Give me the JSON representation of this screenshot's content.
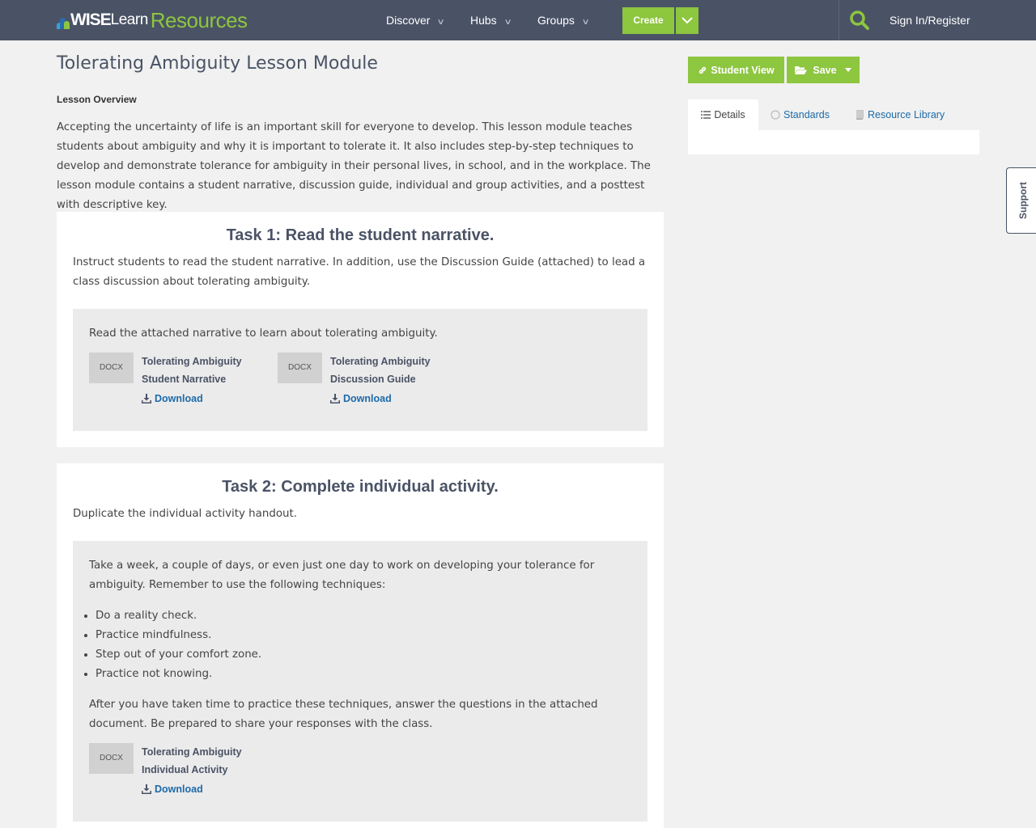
{
  "navbar": {
    "logo": {
      "wise": "WISE",
      "learn": "Learn",
      "resources": "Resources"
    },
    "menu": [
      {
        "label": "Discover"
      },
      {
        "label": "Hubs"
      },
      {
        "label": "Groups"
      }
    ],
    "create_label": "Create",
    "signin_label": "Sign In/Register"
  },
  "page": {
    "title": "Tolerating Ambiguity Lesson Module",
    "overview_label": "Lesson Overview",
    "overview_text": "Accepting the uncertainty of life is an important skill for everyone to develop. This lesson module teaches students about ambiguity and why it is important to tolerate it. It also includes step-by-step techniques to develop and demonstrate tolerance for ambiguity in their personal lives, in school, and in the workplace. The lesson module contains a student narrative, discussion guide, individual and group activities, and a posttest with descriptive key."
  },
  "tasks": [
    {
      "title": "Task 1: Read the student narrative.",
      "instructions": "Instruct students to read the student narrative. In addition, use the Discussion Guide (attached) to lead a class discussion about tolerating ambiguity.",
      "inner_text": "Read the attached narrative to learn about tolerating ambiguity.",
      "attachments": [
        {
          "type": "DOCX",
          "name": "Tolerating Ambiguity Student Narrative",
          "download": "Download"
        },
        {
          "type": "DOCX",
          "name": "Tolerating Ambiguity Discussion Guide",
          "download": "Download"
        }
      ]
    },
    {
      "title": "Task 2: Complete individual activity.",
      "instructions": "Duplicate the individual activity handout.",
      "inner_text": "Take a week, a couple of days, or even just one day to work on developing your tolerance for ambiguity. Remember to use the following techniques:",
      "techniques": [
        "Do a reality check.",
        "Practice mindfulness.",
        "Step out of your comfort zone.",
        "Practice not knowing."
      ],
      "after_text": "After you have taken time to practice these techniques, answer the questions in the attached document. Be prepared to share your responses with the class.",
      "attachments": [
        {
          "type": "DOCX",
          "name": "Tolerating Ambiguity Individual Activity",
          "download": "Download"
        }
      ]
    }
  ],
  "sidebar": {
    "student_view_label": "Student View",
    "save_label": "Save",
    "tabs": [
      {
        "label": "Details",
        "icon": "list-icon",
        "active": true
      },
      {
        "label": "Standards",
        "icon": "circle-icon",
        "active": false
      },
      {
        "label": "Resource Library",
        "icon": "book-icon",
        "active": false
      }
    ]
  },
  "support_label": "Support",
  "colors": {
    "navbar": "#4a5366",
    "accent_green": "#8dc63f",
    "link_blue": "#1d6aa8",
    "page_bg": "#f0f1f0",
    "inner_panel": "#ebebeb"
  }
}
